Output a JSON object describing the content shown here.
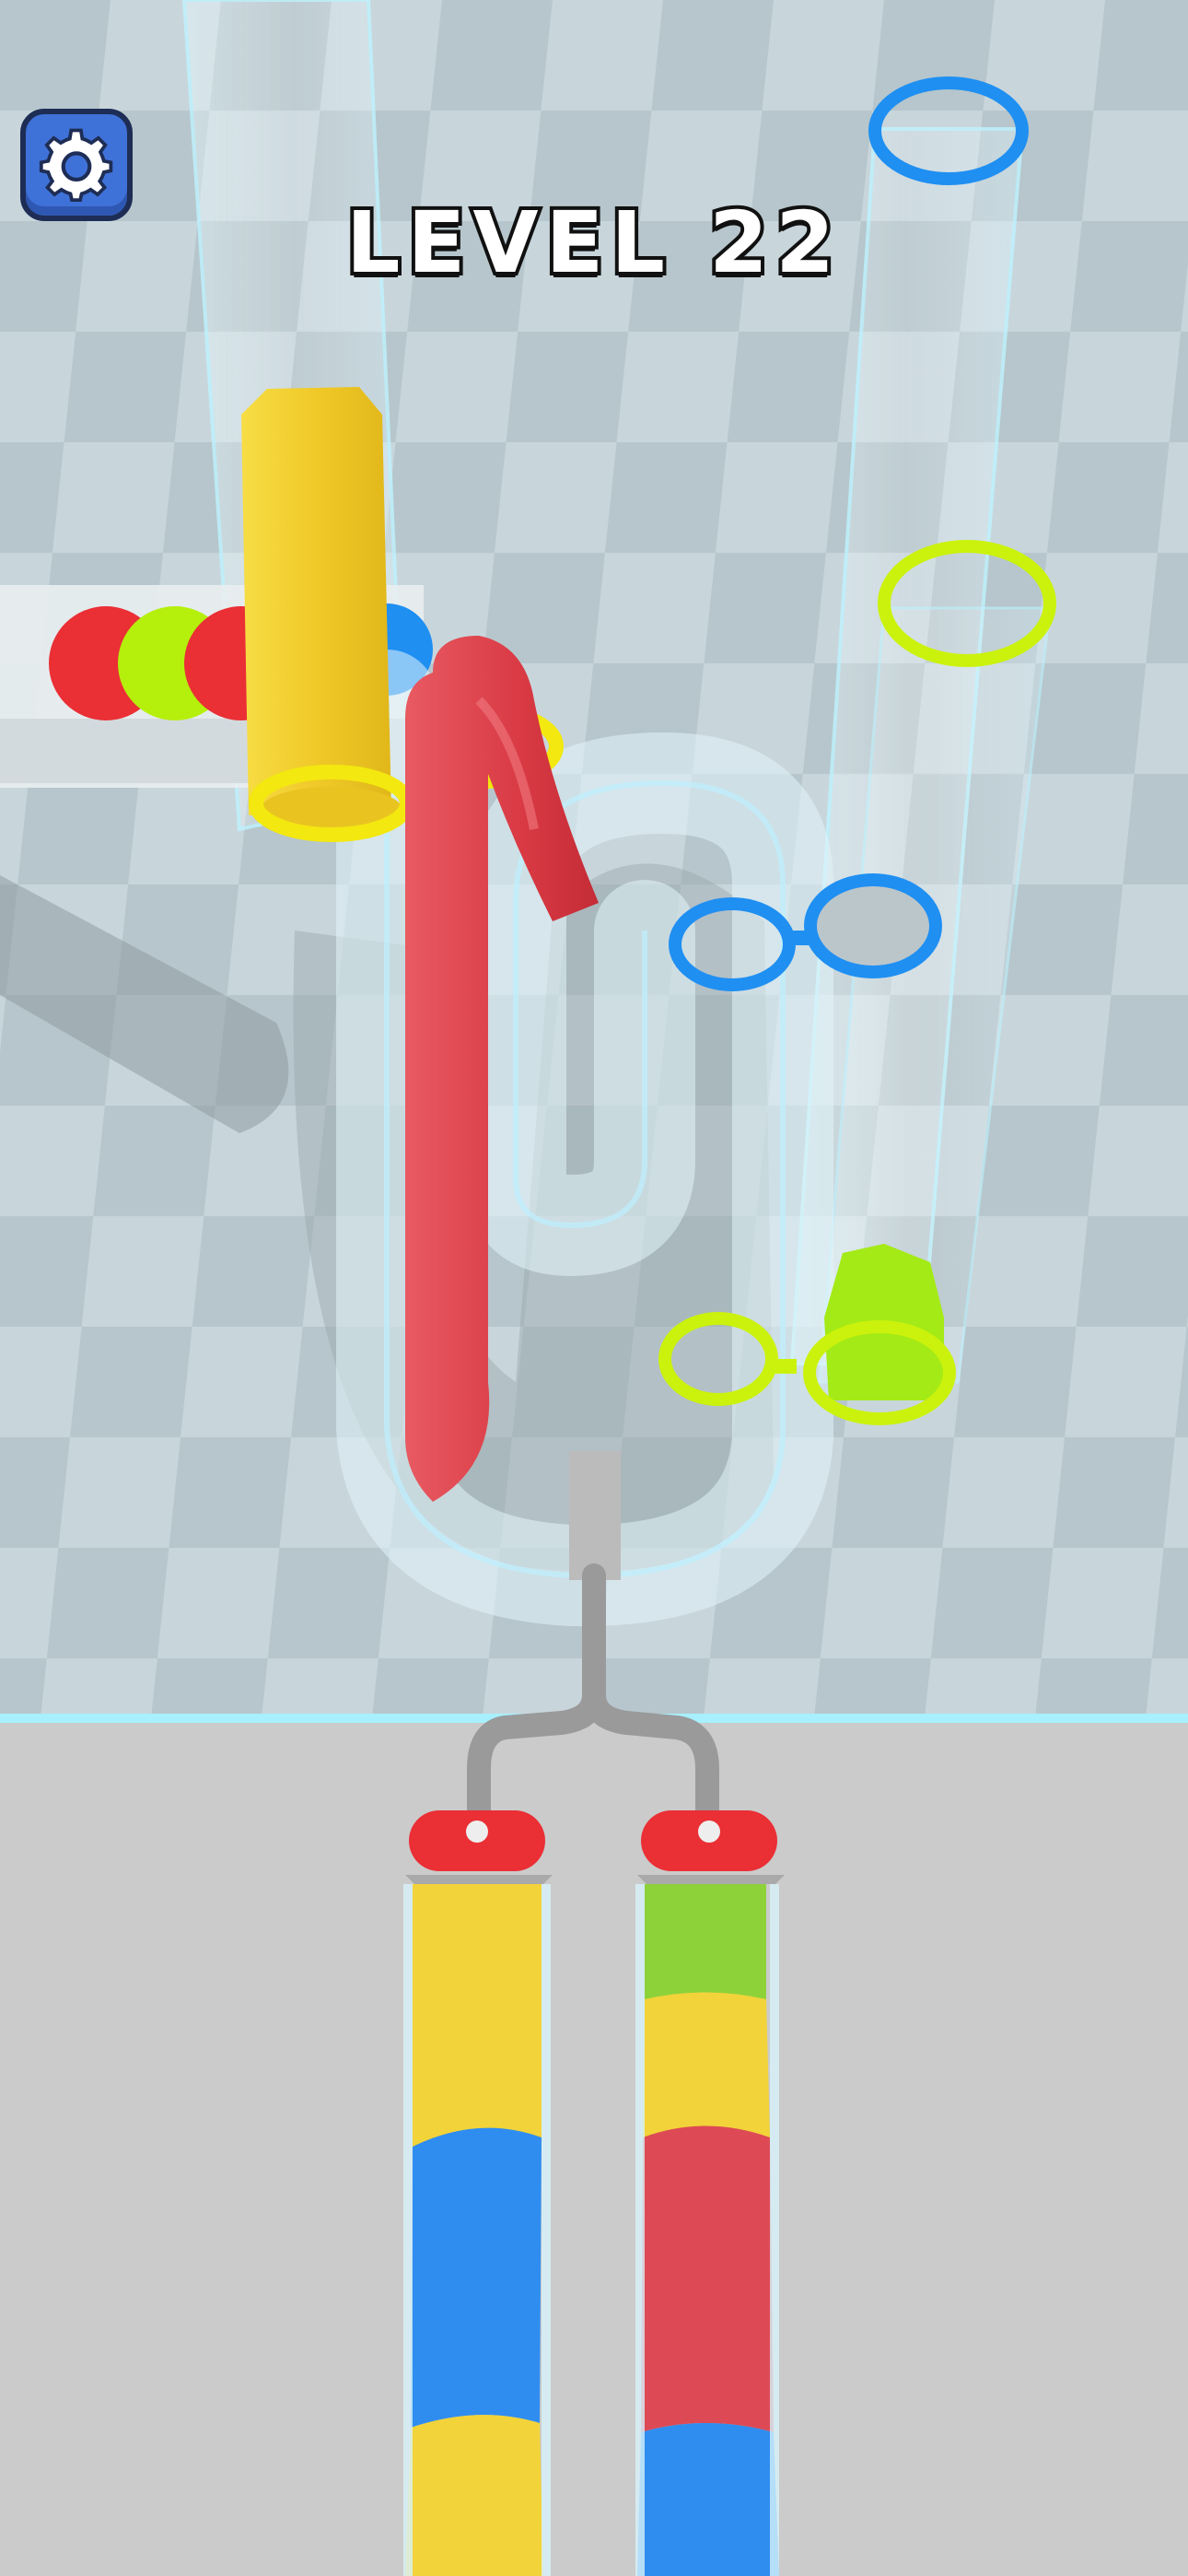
{
  "hud": {
    "level_label": "LEVEL 22",
    "settings_icon": "gear-icon"
  },
  "colors": {
    "red": "#e0434d",
    "yellow": "#f2d33a",
    "lime": "#b6f200",
    "blue": "#1f8ff2",
    "glass": "#d7eef5",
    "floor_checker_a": "#c8d6dc",
    "floor_checker_b": "#b4c4ca",
    "bottom_area": "#c9c9c9",
    "gear_button": "#3f72d8"
  },
  "game": {
    "pipe_left_segments": [
      "yellow",
      "blue",
      "yellow"
    ],
    "pipe_right_segments": [
      "lime",
      "yellow",
      "red",
      "blue"
    ],
    "queue_balls": [
      "red",
      "lime",
      "red",
      "blue"
    ],
    "target_rings": [
      "blue",
      "lime",
      "blue",
      "lime"
    ]
  }
}
